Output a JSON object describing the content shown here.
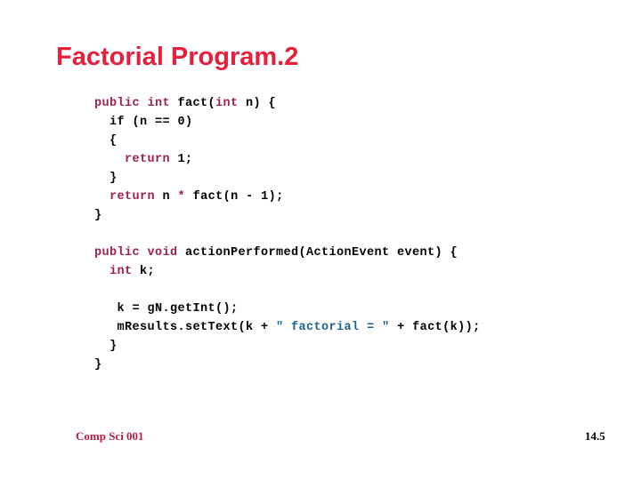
{
  "slide": {
    "title": "Factorial Program.2",
    "title_color": "#e4203c",
    "background_color": "#ffffff"
  },
  "code": {
    "keyword_color": "#a02146",
    "string_color": "#1f6490",
    "plain_color": "#000000",
    "lines": [
      {
        "id": "line-1",
        "indent": "",
        "tokens": [
          {
            "t": "public int",
            "k": "kw"
          },
          {
            "t": " fact(",
            "k": "plain"
          },
          {
            "t": "int",
            "k": "kw"
          },
          {
            "t": " n) {",
            "k": "plain"
          }
        ]
      },
      {
        "id": "line-2",
        "indent": "  ",
        "tokens": [
          {
            "t": "if (n == 0)",
            "k": "plain"
          }
        ]
      },
      {
        "id": "line-3",
        "indent": "  ",
        "tokens": [
          {
            "t": "{",
            "k": "plain"
          }
        ]
      },
      {
        "id": "line-4",
        "indent": "    ",
        "tokens": [
          {
            "t": "return",
            "k": "kw"
          },
          {
            "t": " 1;",
            "k": "plain"
          }
        ]
      },
      {
        "id": "line-5",
        "indent": "  ",
        "tokens": [
          {
            "t": "}",
            "k": "plain"
          }
        ]
      },
      {
        "id": "line-6",
        "indent": "  ",
        "tokens": [
          {
            "t": "return",
            "k": "kw"
          },
          {
            "t": " n ",
            "k": "plain"
          },
          {
            "t": "*",
            "k": "kw"
          },
          {
            "t": " fact(n - 1);",
            "k": "plain"
          }
        ]
      },
      {
        "id": "line-7",
        "indent": "",
        "tokens": [
          {
            "t": "}",
            "k": "plain"
          }
        ]
      },
      {
        "id": "line-8",
        "indent": "",
        "tokens": []
      },
      {
        "id": "line-9",
        "indent": "",
        "tokens": [
          {
            "t": "public void",
            "k": "kw"
          },
          {
            "t": " actionPerformed(ActionEvent event) {",
            "k": "plain"
          }
        ]
      },
      {
        "id": "line-10",
        "indent": "  ",
        "tokens": [
          {
            "t": "int",
            "k": "kw"
          },
          {
            "t": " k;",
            "k": "plain"
          }
        ]
      },
      {
        "id": "line-11",
        "indent": "",
        "tokens": []
      },
      {
        "id": "line-12",
        "indent": "   ",
        "tokens": [
          {
            "t": "k = gN.getInt();",
            "k": "plain"
          }
        ]
      },
      {
        "id": "line-13",
        "indent": "   ",
        "tokens": [
          {
            "t": "mResults.setText(k + ",
            "k": "plain"
          },
          {
            "t": "\" factorial = \"",
            "k": "str"
          },
          {
            "t": " + fact(k));",
            "k": "plain"
          }
        ]
      },
      {
        "id": "line-14",
        "indent": "  ",
        "tokens": [
          {
            "t": "}",
            "k": "plain"
          }
        ]
      },
      {
        "id": "line-15",
        "indent": "",
        "tokens": [
          {
            "t": "}",
            "k": "plain"
          }
        ]
      }
    ]
  },
  "footer": {
    "left_label": "Comp Sci 001",
    "right_label": "14.5"
  }
}
